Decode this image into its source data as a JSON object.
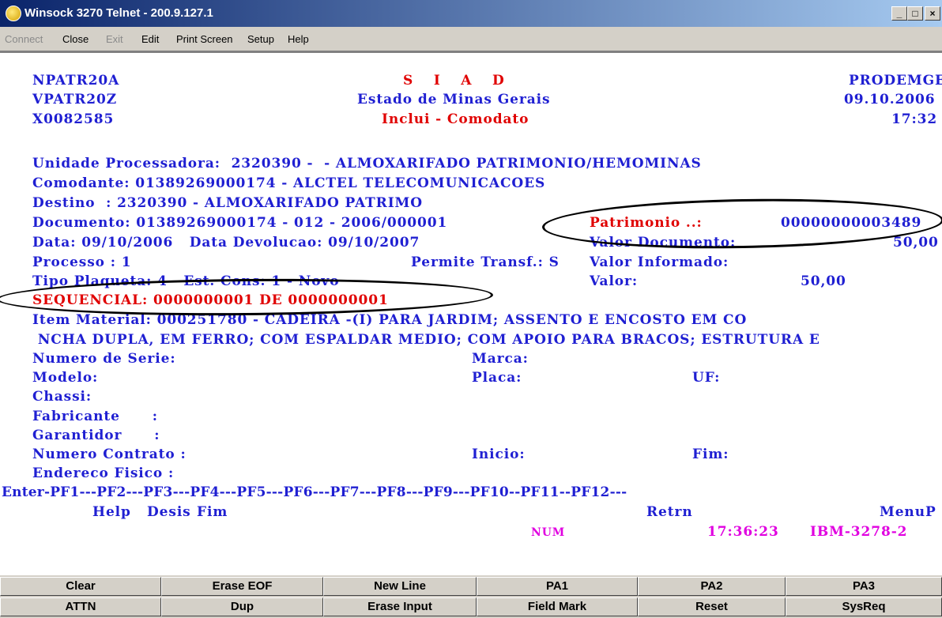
{
  "window": {
    "title": "Winsock 3270 Telnet - 200.9.127.1",
    "minimize_glyph": "_",
    "maximize_glyph": "□",
    "close_glyph": "×"
  },
  "menu": [
    "Connect",
    "Close",
    "Exit",
    "Edit",
    "Print Screen",
    "Setup",
    "Help"
  ],
  "screen": {
    "header": {
      "program": "NPATR20A",
      "title_spaced": "S  I  A  D",
      "company": "PRODEMGE",
      "view": "VPATR20Z",
      "state": "Estado de Minas Gerais",
      "date": "09.10.2006",
      "user": "X0082585",
      "action": "Inclui - Comodato",
      "time": "17:32"
    },
    "lines": {
      "unidade": "Unidade Processadora:  2320390 -  - ALMOXARIFADO PATRIMONIO/HEMOMINAS",
      "comodante": "Comodante: 01389269000174 - ALCTEL TELECOMUNICACOES",
      "destino": "Destino  : 2320390 - ALMOXARIFADO PATRIMO",
      "documento": "Documento: 01389269000174 - 012 - 2006/000001",
      "patrimonio_label": "Patrimonio ..:",
      "patrimonio_value": "00000000003489",
      "data": "Data: 09/10/2006   Data Devolucao: 09/10/2007",
      "valor_documento_label": "Valor Documento:",
      "valor_documento_value": "50,00",
      "processo": "Processo : 1",
      "permite_transf": "Permite Transf.: S",
      "valor_informado_label": "Valor Informado:",
      "tipo_plaqueta": "Tipo Plaqueta: 4   Est. Cons: 1 - Novo",
      "valor_label": "Valor:",
      "valor_value": "50,00",
      "sequencial": "SEQUENCIAL: 0000000001 DE 0000000001",
      "item_material": "Item Material: 000251780 - CADEIRA -(I) PARA JARDIM; ASSENTO E ENCOSTO EM CO",
      "item_material_cont": " NCHA DUPLA, EM FERRO; COM ESPALDAR MEDIO; COM APOIO PARA BRACOS; ESTRUTURA E",
      "numero_serie": "Numero de Serie:",
      "marca": "Marca:",
      "modelo": "Modelo:",
      "placa": "Placa:",
      "uf": "UF:",
      "chassi": "Chassi:",
      "fabricante": "Fabricante      :",
      "garantidor": "Garantidor      :",
      "numero_contrato": "Numero Contrato :",
      "inicio": "Inicio:",
      "fim": "Fim:",
      "endereco_fisico": "Endereco Fisico :"
    },
    "pf_line": "Enter-PF1---PF2---PF3---PF4---PF5---PF6---PF7---PF8---PF9---PF10--PF11--PF12---",
    "pf_labels": {
      "help": "Help",
      "desis": "Desis",
      "fim": "Fim",
      "retrn": "Retrn",
      "menup": "MenuP"
    },
    "status": {
      "num": "NUM",
      "clock": "17:36:23",
      "terminal": "IBM-3278-2"
    }
  },
  "keys_row1": [
    "Clear",
    "Erase EOF",
    "New Line",
    "PA1",
    "PA2",
    "PA3"
  ],
  "keys_row2": [
    "ATTN",
    "Dup",
    "Erase Input",
    "Field Mark",
    "Reset",
    "SysReq"
  ],
  "colors": {
    "terminal_text": "#1f1fd2",
    "highlight_red": "#e00000",
    "status_magenta": "#e000e0",
    "titlebar_start": "#0a246a",
    "titlebar_end": "#a6caf0"
  }
}
